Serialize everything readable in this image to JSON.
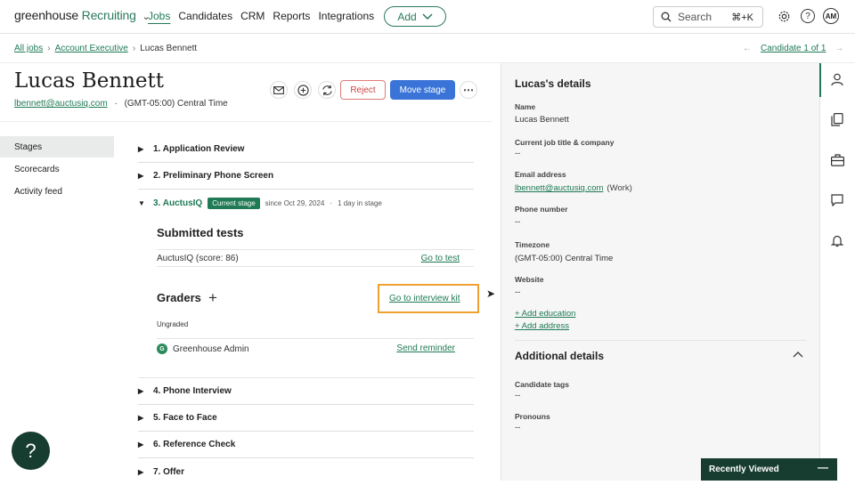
{
  "topbar": {
    "brand": "greenhouse",
    "product": "Recruiting",
    "nav": [
      "Jobs",
      "Candidates",
      "CRM",
      "Reports",
      "Integrations"
    ],
    "add_label": "Add",
    "search_placeholder": "Search",
    "search_shortcut": "⌘+K",
    "avatar_initials": "AM"
  },
  "breadcrumb": {
    "all_jobs": "All jobs",
    "job": "Account Executive",
    "candidate": "Lucas Bennett",
    "candidate_nav": "Candidate 1 of 1"
  },
  "candidate": {
    "name": "Lucas Bennett",
    "email": "lbennett@auctusiq.com",
    "timezone": "(GMT-05:00) Central Time",
    "reject_label": "Reject",
    "move_stage_label": "Move stage"
  },
  "sidenav": [
    "Stages",
    "Scorecards",
    "Activity feed"
  ],
  "stages": {
    "s1": "1. Application Review",
    "s2": "2. Preliminary Phone Screen",
    "s3": "3. AuctusIQ",
    "current_badge": "Current stage",
    "since": "since Oct 29, 2024",
    "in_stage": "1 day in stage",
    "submitted_tests_title": "Submitted tests",
    "test_name": "AuctusIQ (score: 86)",
    "go_to_test": "Go to test",
    "graders_title": "Graders",
    "go_to_kit": "Go to interview kit",
    "ungraded": "Ungraded",
    "grader_initial": "G",
    "grader_name": "Greenhouse Admin",
    "send_reminder": "Send reminder",
    "s4": "4. Phone Interview",
    "s5": "5. Face to Face",
    "s6": "6. Reference Check",
    "s7": "7. Offer"
  },
  "details": {
    "title": "Lucas's details",
    "name_label": "Name",
    "name_value": "Lucas Bennett",
    "job_label": "Current job title & company",
    "job_value": "--",
    "email_label": "Email address",
    "email_value": "lbennett@auctusiq.com",
    "email_type": "(Work)",
    "phone_label": "Phone number",
    "phone_value": "--",
    "tz_label": "Timezone",
    "tz_value": "(GMT-05:00) Central Time",
    "website_label": "Website",
    "website_value": "--",
    "add_education": "+ Add education",
    "add_address": "+ Add address",
    "additional_title": "Additional details",
    "tags_label": "Candidate tags",
    "tags_value": "--",
    "pronouns_label": "Pronouns",
    "pronouns_value": "--"
  },
  "recently_viewed": "Recently Viewed",
  "help_label": "?",
  "colors": {
    "brand_green": "#1f7a55",
    "dark_green": "#173d30",
    "primary_blue": "#3b74d8",
    "reject_red": "#e07a7a",
    "highlight": "#f0a030"
  }
}
